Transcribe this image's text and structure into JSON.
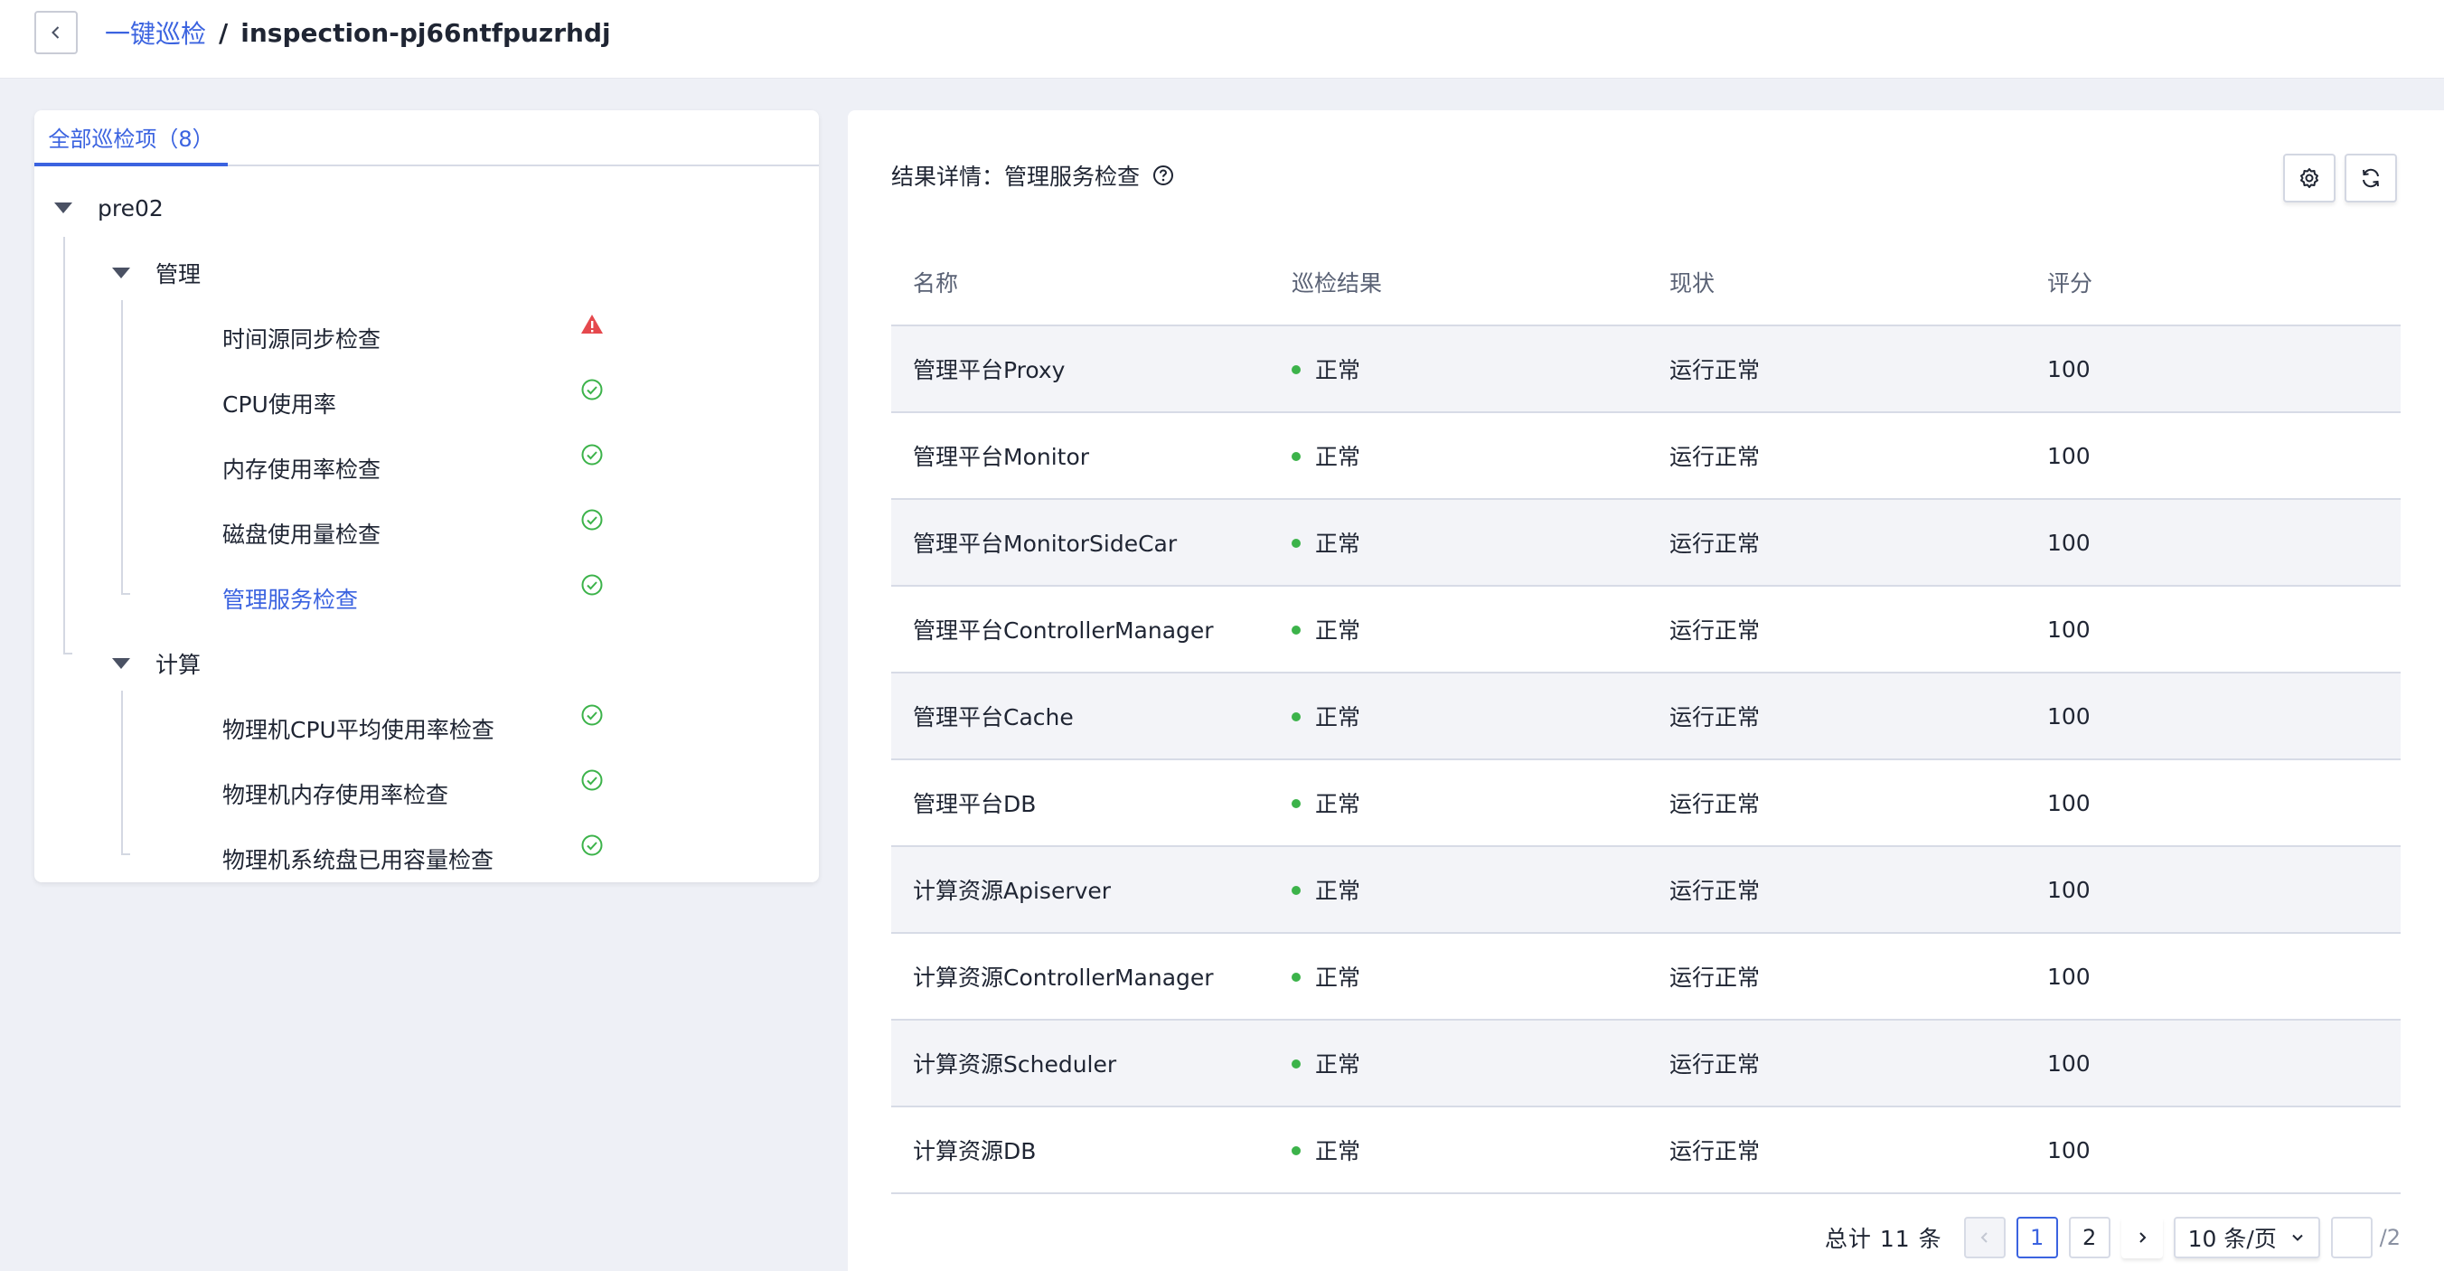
{
  "header": {
    "breadcrumb_parent": "一键巡检",
    "separator": "/",
    "breadcrumb_current": "inspection-pj66ntfpuzrhdj"
  },
  "left_panel": {
    "tab_label": "全部巡检项（8）",
    "tree": {
      "root": "pre02",
      "groups": [
        {
          "label": "管理",
          "items": [
            {
              "label": "时间源同步检查",
              "status": "warning"
            },
            {
              "label": "CPU使用率",
              "status": "ok"
            },
            {
              "label": "内存使用率检查",
              "status": "ok"
            },
            {
              "label": "磁盘使用量检查",
              "status": "ok"
            },
            {
              "label": "管理服务检查",
              "status": "ok",
              "selected": true
            }
          ]
        },
        {
          "label": "计算",
          "items": [
            {
              "label": "物理机CPU平均使用率检查",
              "status": "ok"
            },
            {
              "label": "物理机内存使用率检查",
              "status": "ok"
            },
            {
              "label": "物理机系统盘已用容量检查",
              "status": "ok"
            }
          ]
        }
      ]
    }
  },
  "detail": {
    "title": "结果详情：管理服务检查",
    "columns": [
      "名称",
      "巡检结果",
      "现状",
      "评分"
    ],
    "rows": [
      {
        "name": "管理平台Proxy",
        "result": "正常",
        "state": "运行正常",
        "score": "100"
      },
      {
        "name": "管理平台Monitor",
        "result": "正常",
        "state": "运行正常",
        "score": "100"
      },
      {
        "name": "管理平台MonitorSideCar",
        "result": "正常",
        "state": "运行正常",
        "score": "100"
      },
      {
        "name": "管理平台ControllerManager",
        "result": "正常",
        "state": "运行正常",
        "score": "100"
      },
      {
        "name": "管理平台Cache",
        "result": "正常",
        "state": "运行正常",
        "score": "100"
      },
      {
        "name": "管理平台DB",
        "result": "正常",
        "state": "运行正常",
        "score": "100"
      },
      {
        "name": "计算资源Apiserver",
        "result": "正常",
        "state": "运行正常",
        "score": "100"
      },
      {
        "name": "计算资源ControllerManager",
        "result": "正常",
        "state": "运行正常",
        "score": "100"
      },
      {
        "name": "计算资源Scheduler",
        "result": "正常",
        "state": "运行正常",
        "score": "100"
      },
      {
        "name": "计算资源DB",
        "result": "正常",
        "state": "运行正常",
        "score": "100"
      }
    ],
    "pagination": {
      "total_label": "总计 11 条",
      "pages": [
        "1",
        "2"
      ],
      "current_page": "1",
      "page_size": "10 条/页",
      "jump_value": "",
      "total_pages": "/2"
    }
  },
  "colors": {
    "accent": "#3b63e0",
    "ok": "#3cb34a",
    "warning": "#e5484d",
    "page_bg": "#eef0f6"
  },
  "icons": {
    "back": "chevron-left-icon",
    "help": "question-circle-icon",
    "settings": "gear-icon",
    "refresh": "refresh-icon",
    "warning": "warning-triangle-icon",
    "ok": "check-circle-icon"
  }
}
